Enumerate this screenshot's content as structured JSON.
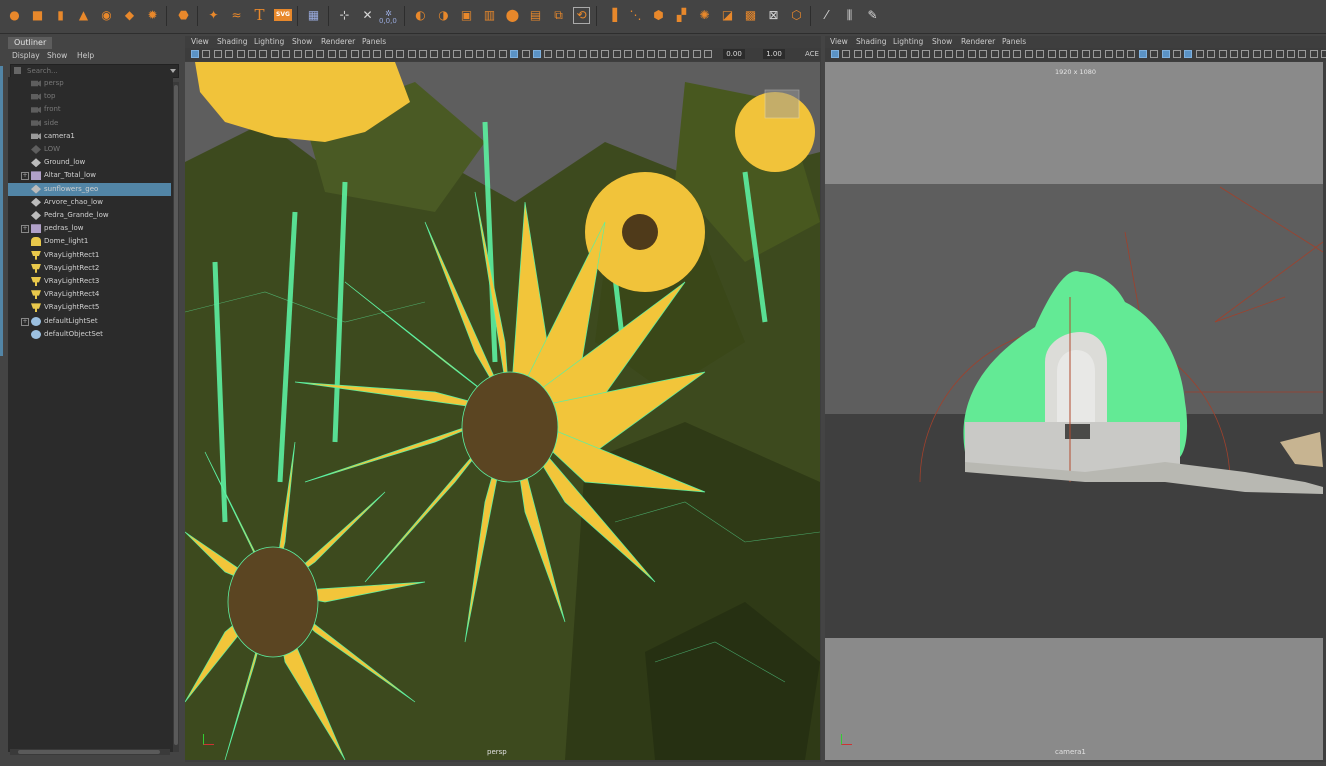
{
  "shelf": {
    "icons": [
      "sphere-icon",
      "cube-icon",
      "cylinder-icon",
      "cone-icon",
      "torus-icon",
      "plane-icon",
      "gear-icon",
      "superellipse-icon",
      "sweep-icon",
      "text-tool-icon",
      "svg-tool-icon",
      "uv-grid-icon",
      "center-pivot-icon",
      "freeze-transforms-icon",
      "delete-history-icon",
      "combine-icon",
      "separate-icon",
      "extrude-icon",
      "bridge-icon",
      "bevel-icon",
      "fill-hole-icon",
      "smooth-icon",
      "mirror-icon",
      "edge-loop-icon",
      "bend-icon",
      "flatten-icon",
      "target-weld-icon",
      "multi-cut-icon",
      "knife-icon",
      "lattice-icon",
      "cluster-icon",
      "ruler-icon",
      "measure-icon",
      "sculpt-icon"
    ],
    "text_tool_glyph": "T",
    "svg_tool_glyph": "SVG",
    "coord_readout": "0,0,0"
  },
  "outliner": {
    "tab": "Outliner",
    "menu": [
      "Display",
      "Show",
      "Help"
    ],
    "search_placeholder": "Search...",
    "items": [
      {
        "label": "persp",
        "icon": "camera-icon",
        "dim": true,
        "expand": false,
        "selected": false
      },
      {
        "label": "top",
        "icon": "camera-icon",
        "dim": true,
        "expand": false,
        "selected": false
      },
      {
        "label": "front",
        "icon": "camera-icon",
        "dim": true,
        "expand": false,
        "selected": false
      },
      {
        "label": "side",
        "icon": "camera-icon",
        "dim": true,
        "expand": false,
        "selected": false
      },
      {
        "label": "camera1",
        "icon": "camera-icon",
        "dim": false,
        "expand": false,
        "selected": false
      },
      {
        "label": "LOW",
        "icon": "mesh-icon",
        "dim": true,
        "expand": false,
        "selected": false
      },
      {
        "label": "Ground_low",
        "icon": "mesh-icon",
        "dim": false,
        "expand": false,
        "selected": false
      },
      {
        "label": "Altar_Total_low",
        "icon": "group-icon",
        "dim": false,
        "expand": true,
        "selected": false
      },
      {
        "label": "sunflowers_geo",
        "icon": "mesh-icon",
        "dim": false,
        "expand": false,
        "selected": true
      },
      {
        "label": "Arvore_chao_low",
        "icon": "mesh-icon",
        "dim": false,
        "expand": false,
        "selected": false
      },
      {
        "label": "Pedra_Grande_low",
        "icon": "mesh-icon",
        "dim": false,
        "expand": false,
        "selected": false
      },
      {
        "label": "pedras_low",
        "icon": "group-icon",
        "dim": false,
        "expand": true,
        "selected": false
      },
      {
        "label": "Dome_light1",
        "icon": "dome-light-icon",
        "dim": false,
        "expand": false,
        "selected": false
      },
      {
        "label": "VRayLightRect1",
        "icon": "rect-light-icon",
        "dim": false,
        "expand": false,
        "selected": false
      },
      {
        "label": "VRayLightRect2",
        "icon": "rect-light-icon",
        "dim": false,
        "expand": false,
        "selected": false
      },
      {
        "label": "VRayLightRect3",
        "icon": "rect-light-icon",
        "dim": false,
        "expand": false,
        "selected": false
      },
      {
        "label": "VRayLightRect4",
        "icon": "rect-light-icon",
        "dim": false,
        "expand": false,
        "selected": false
      },
      {
        "label": "VRayLightRect5",
        "icon": "rect-light-icon",
        "dim": false,
        "expand": false,
        "selected": false
      },
      {
        "label": "defaultLightSet",
        "icon": "set-icon",
        "dim": false,
        "expand": true,
        "selected": false
      },
      {
        "label": "defaultObjectSet",
        "icon": "set-icon",
        "dim": false,
        "expand": false,
        "selected": false
      }
    ]
  },
  "viewport_left": {
    "menu": [
      "View",
      "Shading",
      "Lighting",
      "Show",
      "Renderer",
      "Panels"
    ],
    "exposure": "0.00",
    "gamma": "1.00",
    "colorspace": "ACE",
    "camera_label": "persp"
  },
  "viewport_right": {
    "menu": [
      "View",
      "Shading",
      "Lighting",
      "Show",
      "Renderer",
      "Panels"
    ],
    "resolution": "1920 x 1080",
    "camera_label": "camera1"
  },
  "colors": {
    "accent_orange": "#e8882b",
    "selection": "#5285a6",
    "wire_green": "#5cf0a0",
    "petal_yellow": "#f2c53a"
  }
}
